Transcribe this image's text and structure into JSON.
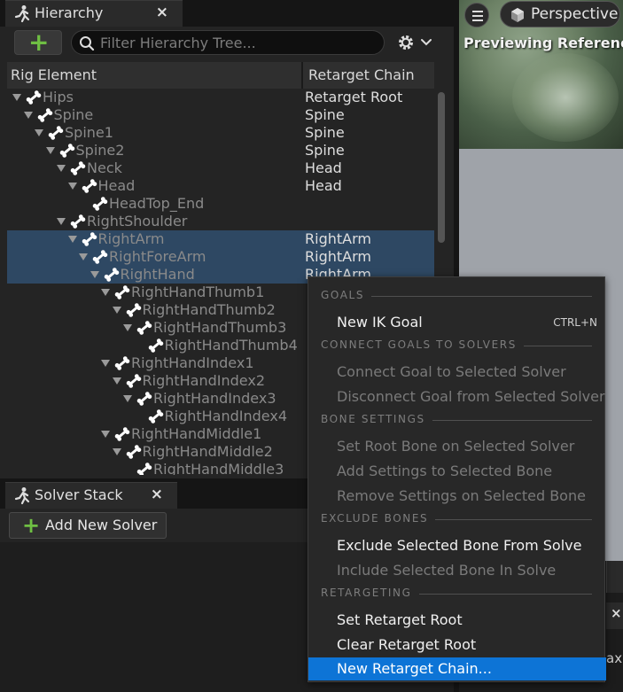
{
  "hierarchy": {
    "tab_title": "Hierarchy",
    "close_glyph": "×",
    "add_glyph": "+",
    "search_placeholder": "Filter Hierarchy Tree...",
    "col_element": "Rig Element",
    "col_chain": "Retarget Chain",
    "rows": [
      {
        "name": "Hips",
        "chain": "Retarget Root",
        "depth": 0
      },
      {
        "name": "Spine",
        "chain": "Spine",
        "depth": 1
      },
      {
        "name": "Spine1",
        "chain": "Spine",
        "depth": 2
      },
      {
        "name": "Spine2",
        "chain": "Spine",
        "depth": 3
      },
      {
        "name": "Neck",
        "chain": "Head",
        "depth": 4
      },
      {
        "name": "Head",
        "chain": "Head",
        "depth": 5
      },
      {
        "name": "HeadTop_End",
        "chain": "",
        "depth": 6
      },
      {
        "name": "RightShoulder",
        "chain": "",
        "depth": 4
      },
      {
        "name": "RightArm",
        "chain": "RightArm",
        "depth": 5,
        "selected": true
      },
      {
        "name": "RightForeArm",
        "chain": "RightArm",
        "depth": 6,
        "selected": true
      },
      {
        "name": "RightHand",
        "chain": "RightArm",
        "depth": 7,
        "selected": true
      },
      {
        "name": "RightHandThumb1",
        "chain": "",
        "depth": 8
      },
      {
        "name": "RightHandThumb2",
        "chain": "",
        "depth": 9
      },
      {
        "name": "RightHandThumb3",
        "chain": "",
        "depth": 10
      },
      {
        "name": "RightHandThumb4",
        "chain": "",
        "depth": 11
      },
      {
        "name": "RightHandIndex1",
        "chain": "",
        "depth": 8
      },
      {
        "name": "RightHandIndex2",
        "chain": "",
        "depth": 9
      },
      {
        "name": "RightHandIndex3",
        "chain": "",
        "depth": 10
      },
      {
        "name": "RightHandIndex4",
        "chain": "",
        "depth": 11
      },
      {
        "name": "RightHandMiddle1",
        "chain": "",
        "depth": 8
      },
      {
        "name": "RightHandMiddle2",
        "chain": "",
        "depth": 9
      },
      {
        "name": "RightHandMiddle3",
        "chain": "",
        "depth": 10
      }
    ]
  },
  "solver": {
    "tab_title": "Solver Stack",
    "close_glyph": "×",
    "add_glyph": "+",
    "add_label": "Add New Solver"
  },
  "viewport": {
    "view_mode": "Perspective",
    "preview_text": "Previewing Reference Pose",
    "close_glyph": "×",
    "cut_text": "ax"
  },
  "context_menu": {
    "sections": [
      {
        "title": "GOALS",
        "items": [
          {
            "label": "New IK Goal",
            "shortcut": "CTRL+N",
            "enabled": true
          }
        ]
      },
      {
        "title": "CONNECT GOALS TO SOLVERS",
        "items": [
          {
            "label": "Connect Goal to Selected Solver",
            "enabled": false
          },
          {
            "label": "Disconnect Goal from Selected Solver",
            "enabled": false
          }
        ]
      },
      {
        "title": "BONE SETTINGS",
        "items": [
          {
            "label": "Set Root Bone on Selected Solver",
            "enabled": false
          },
          {
            "label": "Add Settings to Selected Bone",
            "enabled": false
          },
          {
            "label": "Remove Settings on Selected Bone",
            "enabled": false
          }
        ]
      },
      {
        "title": "EXCLUDE BONES",
        "items": [
          {
            "label": "Exclude Selected Bone From Solve",
            "enabled": true
          },
          {
            "label": "Include Selected Bone In Solve",
            "enabled": false
          }
        ]
      },
      {
        "title": "RETARGETING",
        "items": [
          {
            "label": "Set Retarget Root",
            "enabled": true
          },
          {
            "label": "Clear Retarget Root",
            "enabled": true
          },
          {
            "label": "New Retarget Chain...",
            "enabled": true,
            "highlighted": true
          }
        ]
      }
    ]
  },
  "colors": {
    "accent_highlight": "#0d74d6",
    "selection_row": "#2e4863",
    "add_green": "#6fbf43"
  },
  "icons": [
    "running-man-icon",
    "search-icon",
    "gear-icon",
    "chevron-down-icon",
    "bone-icon",
    "close-icon",
    "hamburger-menu-icon",
    "cube-icon"
  ]
}
